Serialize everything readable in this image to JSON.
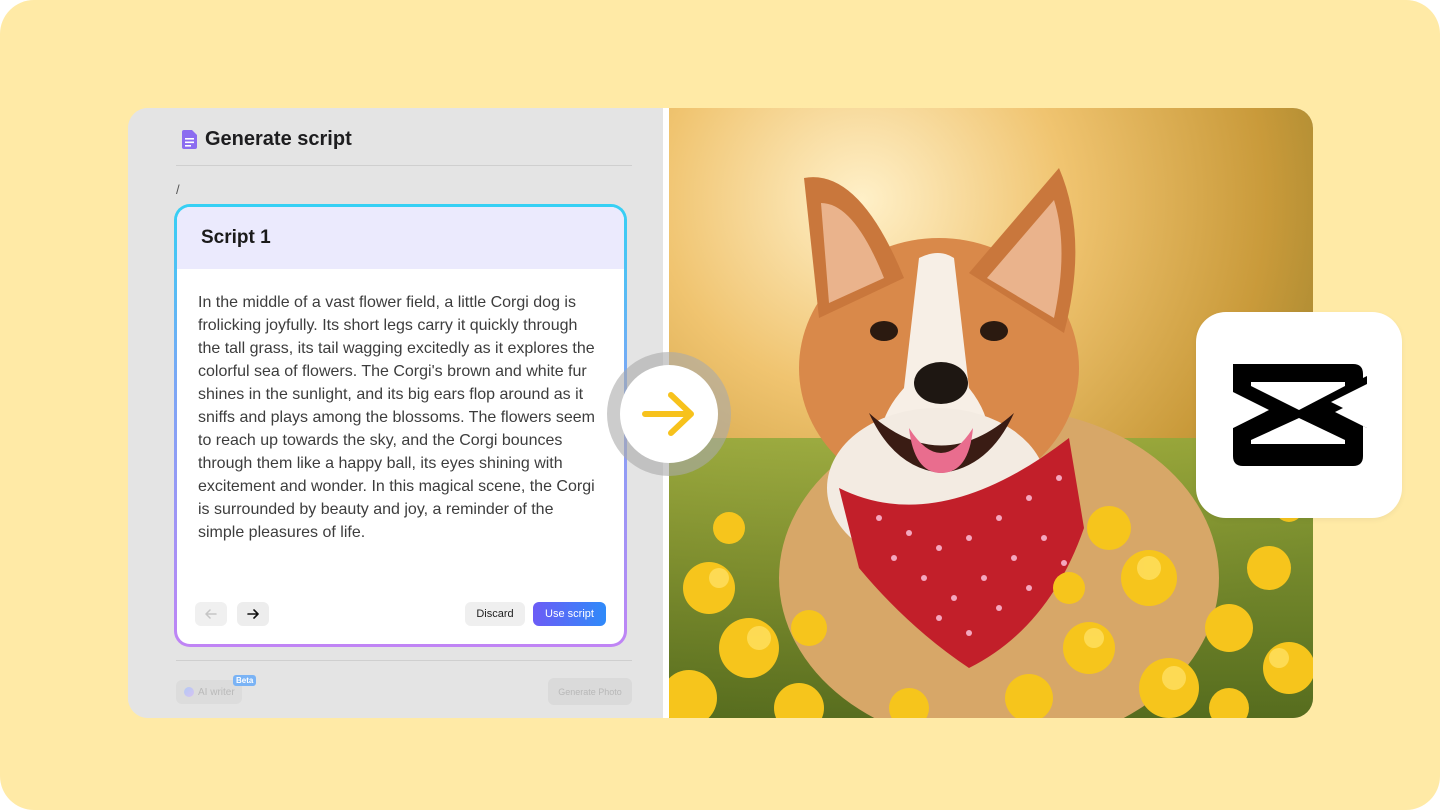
{
  "panel": {
    "title": "Generate script",
    "breadcrumb": "/",
    "script": {
      "title": "Script 1",
      "body": "In the middle of a vast flower field, a little Corgi dog is frolicking joyfully. Its short legs carry it quickly through the tall grass, its tail wagging excitedly as it explores the colorful sea of flowers. The Corgi's brown and white fur shines in the sunlight, and its big ears flop around as it sniffs and plays among the blossoms. The flowers seem to reach up towards the sky, and the Corgi bounces through them like a happy ball, its eyes shining with excitement and wonder. In this magical scene, the Corgi is surrounded by beauty and joy, a reminder of the simple pleasures of life.",
      "discard_label": "Discard",
      "use_label": "Use script"
    },
    "footer": {
      "ai_writer_label": "AI writer",
      "beta_badge": "Beta",
      "generate_photo_label": "Generate Photo"
    }
  },
  "icons": {
    "document": "document-icon",
    "prev": "arrow-left-icon",
    "next": "arrow-right-icon",
    "transition": "arrow-right-icon",
    "logo": "capcut-logo"
  },
  "colors": {
    "background": "#ffeaa6",
    "accent_arrow": "#f7c21c",
    "use_button_start": "#6c5cf6",
    "use_button_end": "#2f8af9",
    "doc_icon": "#8b6cf0"
  }
}
